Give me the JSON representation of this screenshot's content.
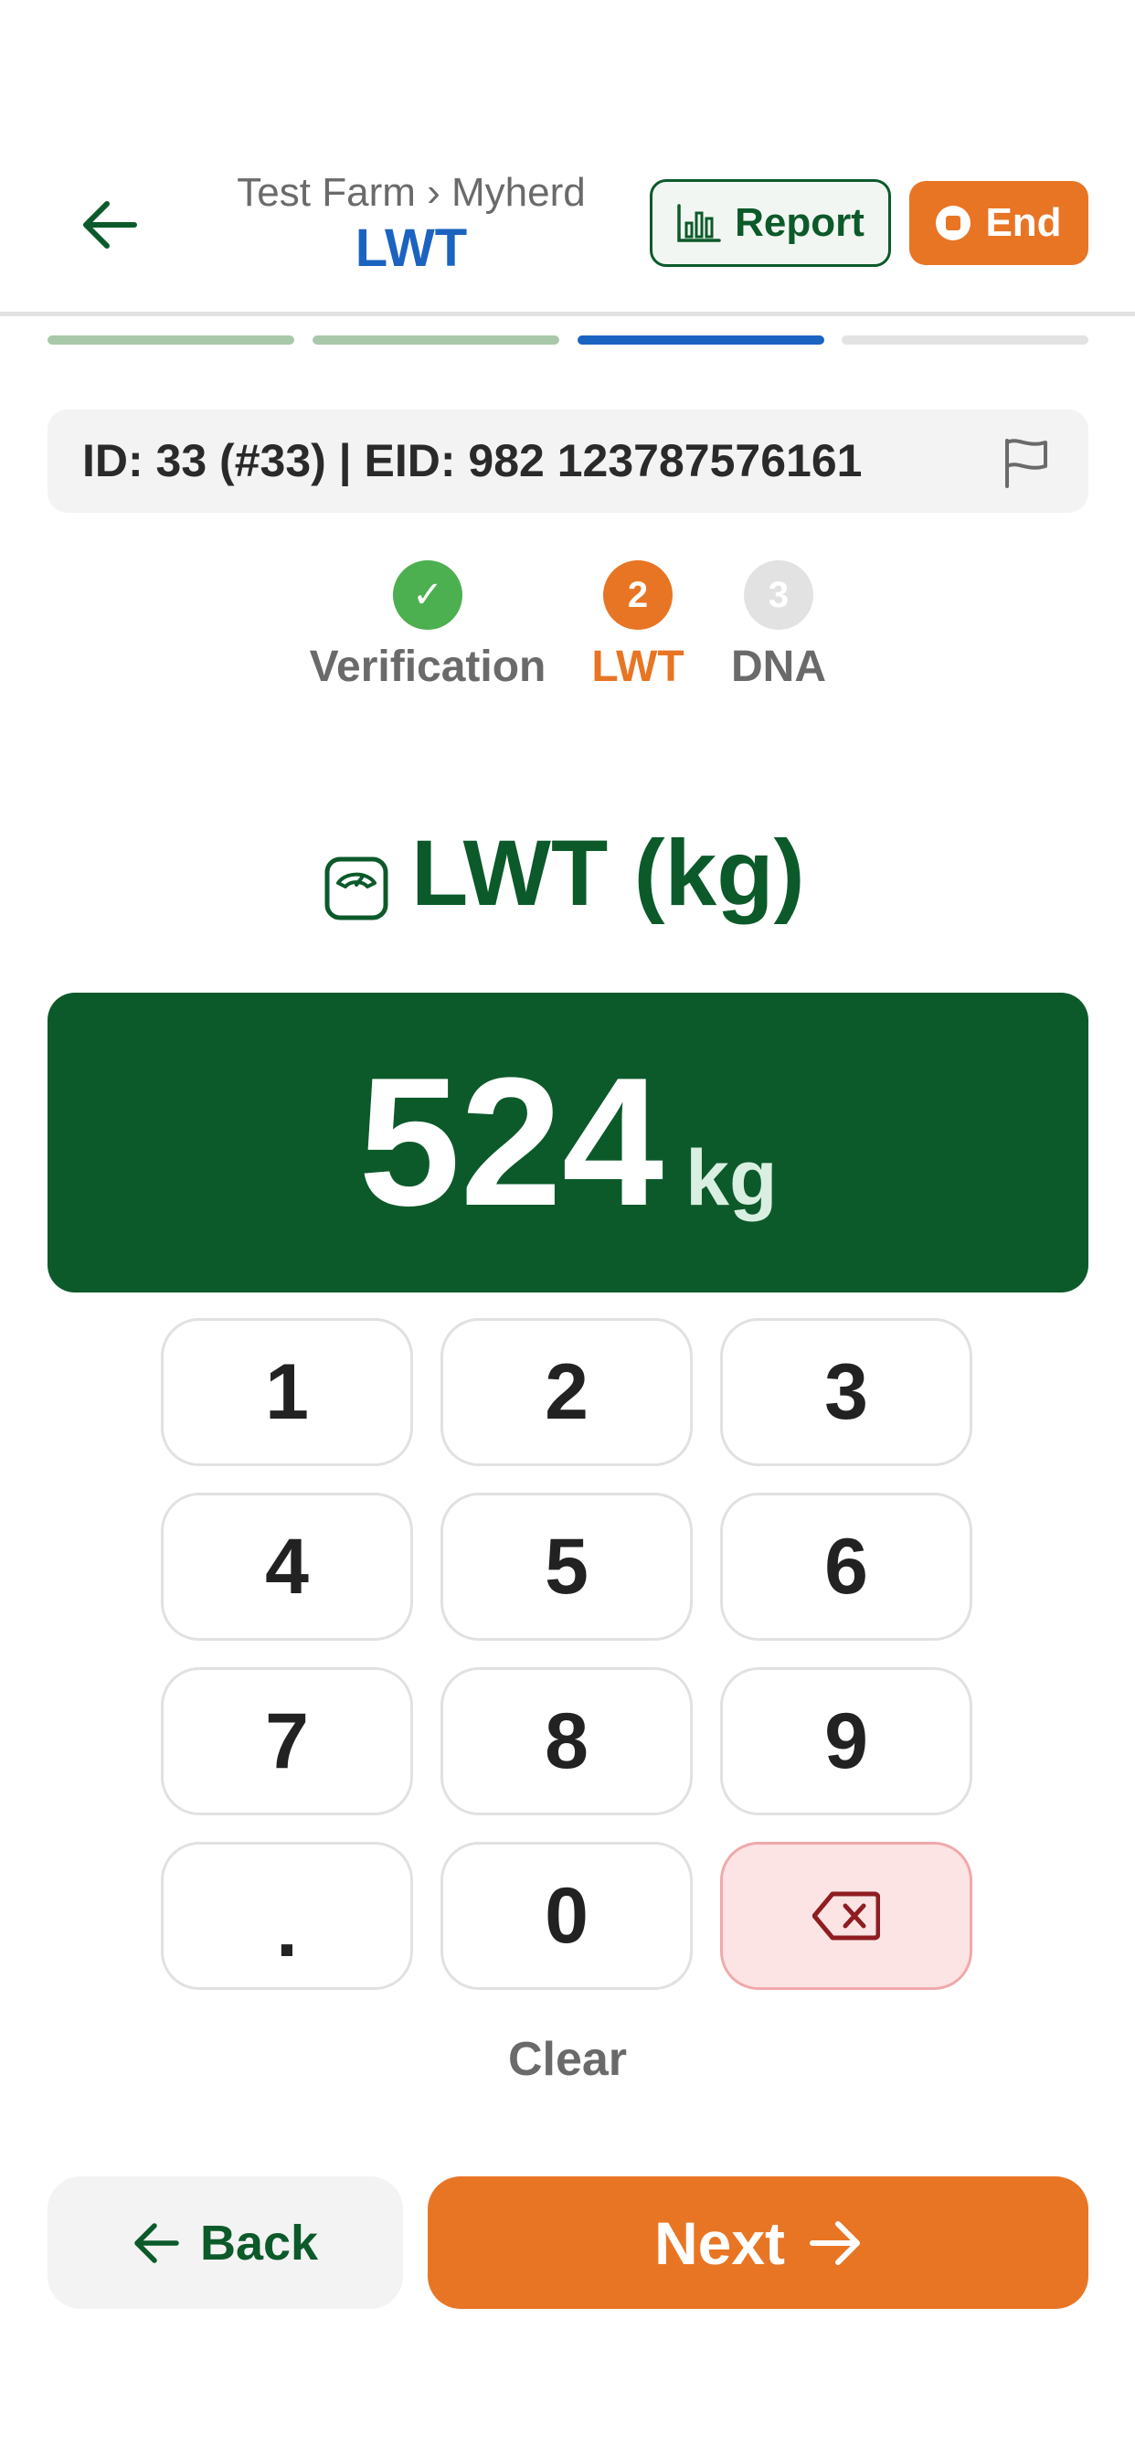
{
  "colors": {
    "brand_green": "#0c5a2a",
    "accent_orange": "#e87524",
    "title_blue": "#1b63c0",
    "step_done_green": "#4caf50",
    "progress_done": "#a9c8a9",
    "progress_active": "#1b63c0",
    "progress_pending": "#e2e2e2",
    "delete_bg": "#fce4e4"
  },
  "header": {
    "breadcrumb": "Test Farm › Myherd",
    "title": "LWT",
    "report_label": "Report",
    "end_label": "End",
    "back_icon": "arrow-left-icon",
    "report_icon": "bar-chart-icon",
    "end_icon": "stop-circle-icon"
  },
  "progress": {
    "segments": [
      "done",
      "done",
      "active",
      "pending"
    ]
  },
  "animal": {
    "id_text": "ID: 33 (#33) | EID: 982 123787576161",
    "flag_icon": "flag-icon"
  },
  "steps": [
    {
      "number": "✓",
      "label": "Verification",
      "status": "done"
    },
    {
      "number": "2",
      "label": "LWT",
      "status": "active"
    },
    {
      "number": "3",
      "label": "DNA",
      "status": "pending"
    }
  ],
  "section": {
    "title": "LWT (kg)",
    "icon": "scale-icon"
  },
  "value": {
    "number": "524",
    "unit": "kg"
  },
  "keypad": {
    "keys": [
      "1",
      "2",
      "3",
      "4",
      "5",
      "6",
      "7",
      "8",
      "9",
      ".",
      "0"
    ],
    "delete_icon": "backspace-icon",
    "clear_label": "Clear"
  },
  "footer": {
    "back_label": "Back",
    "next_label": "Next"
  }
}
